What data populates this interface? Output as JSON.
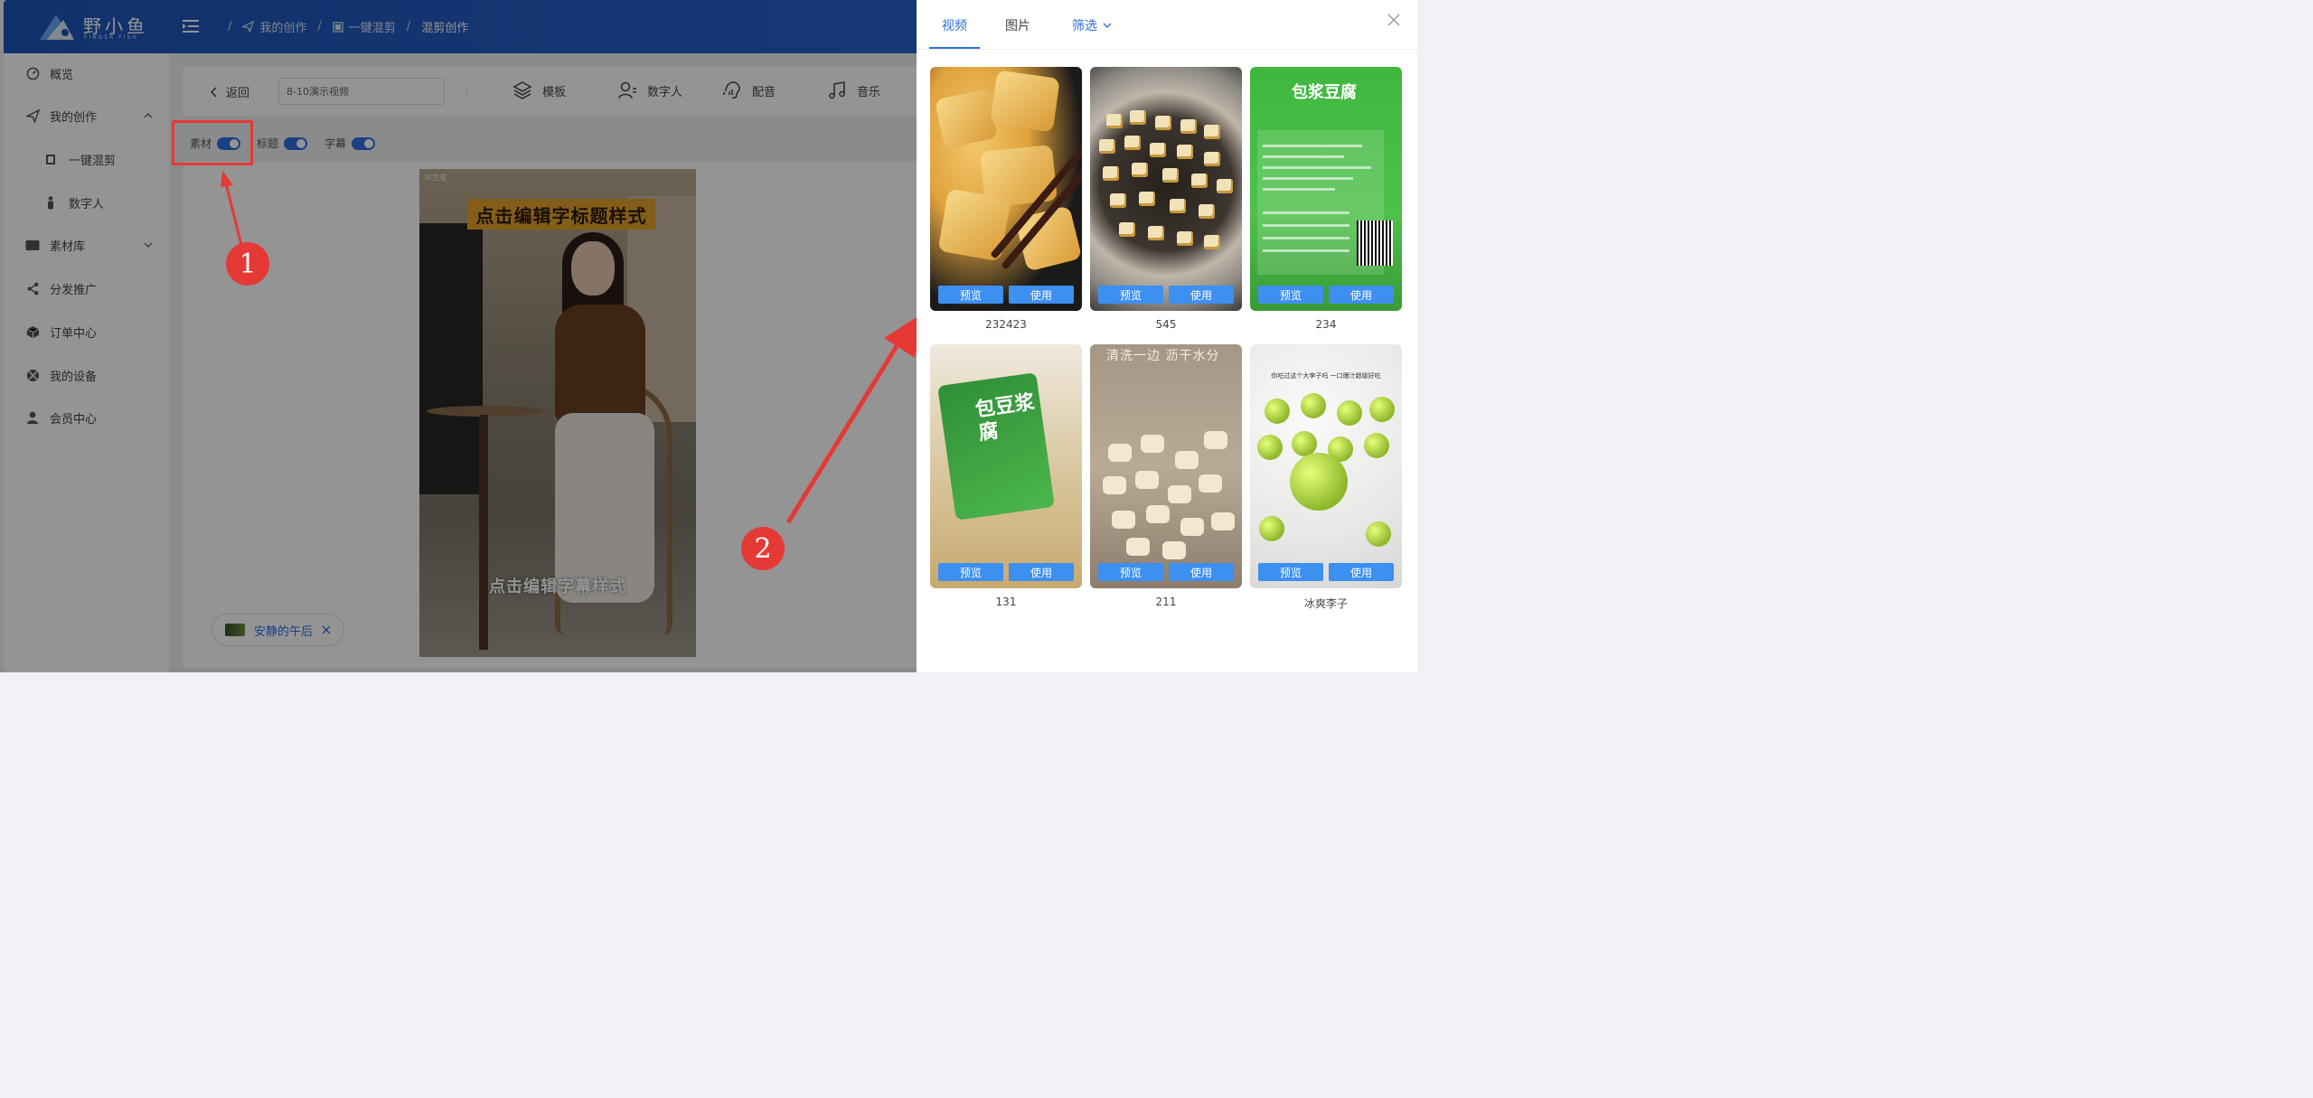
{
  "app": {
    "logo_name": "野小鱼",
    "logo_sub": "FINGER FISH"
  },
  "breadcrumb": [
    "我的创作",
    "一键混剪",
    "混剪创作"
  ],
  "sidebar": {
    "items": [
      {
        "label": "概览",
        "icon": "dashboard-icon"
      },
      {
        "label": "我的创作",
        "icon": "send-icon"
      },
      {
        "label": "一键混剪",
        "icon": "film-icon"
      },
      {
        "label": "数字人",
        "icon": "person-icon"
      },
      {
        "label": "素材库",
        "icon": "folder-icon"
      },
      {
        "label": "分发推广",
        "icon": "share-icon"
      },
      {
        "label": "订单中心",
        "icon": "box-icon"
      },
      {
        "label": "我的设备",
        "icon": "device-icon"
      },
      {
        "label": "会员中心",
        "icon": "user-icon"
      }
    ]
  },
  "toolbar": {
    "back_label": "返回",
    "title_value": "8-10演示视频",
    "tools": [
      {
        "label": "模板",
        "icon": "layers-icon"
      },
      {
        "label": "数字人",
        "icon": "avatar-icon"
      },
      {
        "label": "配音",
        "icon": "voice-icon"
      },
      {
        "label": "音乐",
        "icon": "music-icon"
      }
    ]
  },
  "toggles": [
    {
      "label": "素材",
      "on": true
    },
    {
      "label": "标题",
      "on": true
    },
    {
      "label": "字幕",
      "on": true
    }
  ],
  "preview": {
    "title_text": "点击编辑字标题样式",
    "subtitle_text": "点击编辑字幕样式",
    "watermark": "AI生成"
  },
  "music_chip": {
    "label": "安静的午后"
  },
  "annotations": [
    "1",
    "2"
  ],
  "drawer": {
    "tabs": [
      {
        "label": "视频",
        "active": true
      },
      {
        "label": "图片",
        "active": false
      },
      {
        "label": "筛选",
        "active": false
      }
    ],
    "preview_label": "预览",
    "use_label": "使用",
    "items": [
      {
        "name": "232423"
      },
      {
        "name": "545"
      },
      {
        "name": "234"
      },
      {
        "name": "131"
      },
      {
        "name": "211"
      },
      {
        "name": "冰爽李子"
      }
    ],
    "thumb_text": {
      "pack_brand": "包浆豆腐",
      "pack_small": "包豆浆腐",
      "wash_caption": "清洗一边 沥干水分",
      "plum_caption": "你吃过这个大李子吗 一口爆汁超级好吃"
    }
  },
  "colors": {
    "accent": "#2f6fde",
    "topbar": "#1d54b8",
    "annotation_red": "#e53935",
    "button_blue": "#3d8ff0"
  }
}
